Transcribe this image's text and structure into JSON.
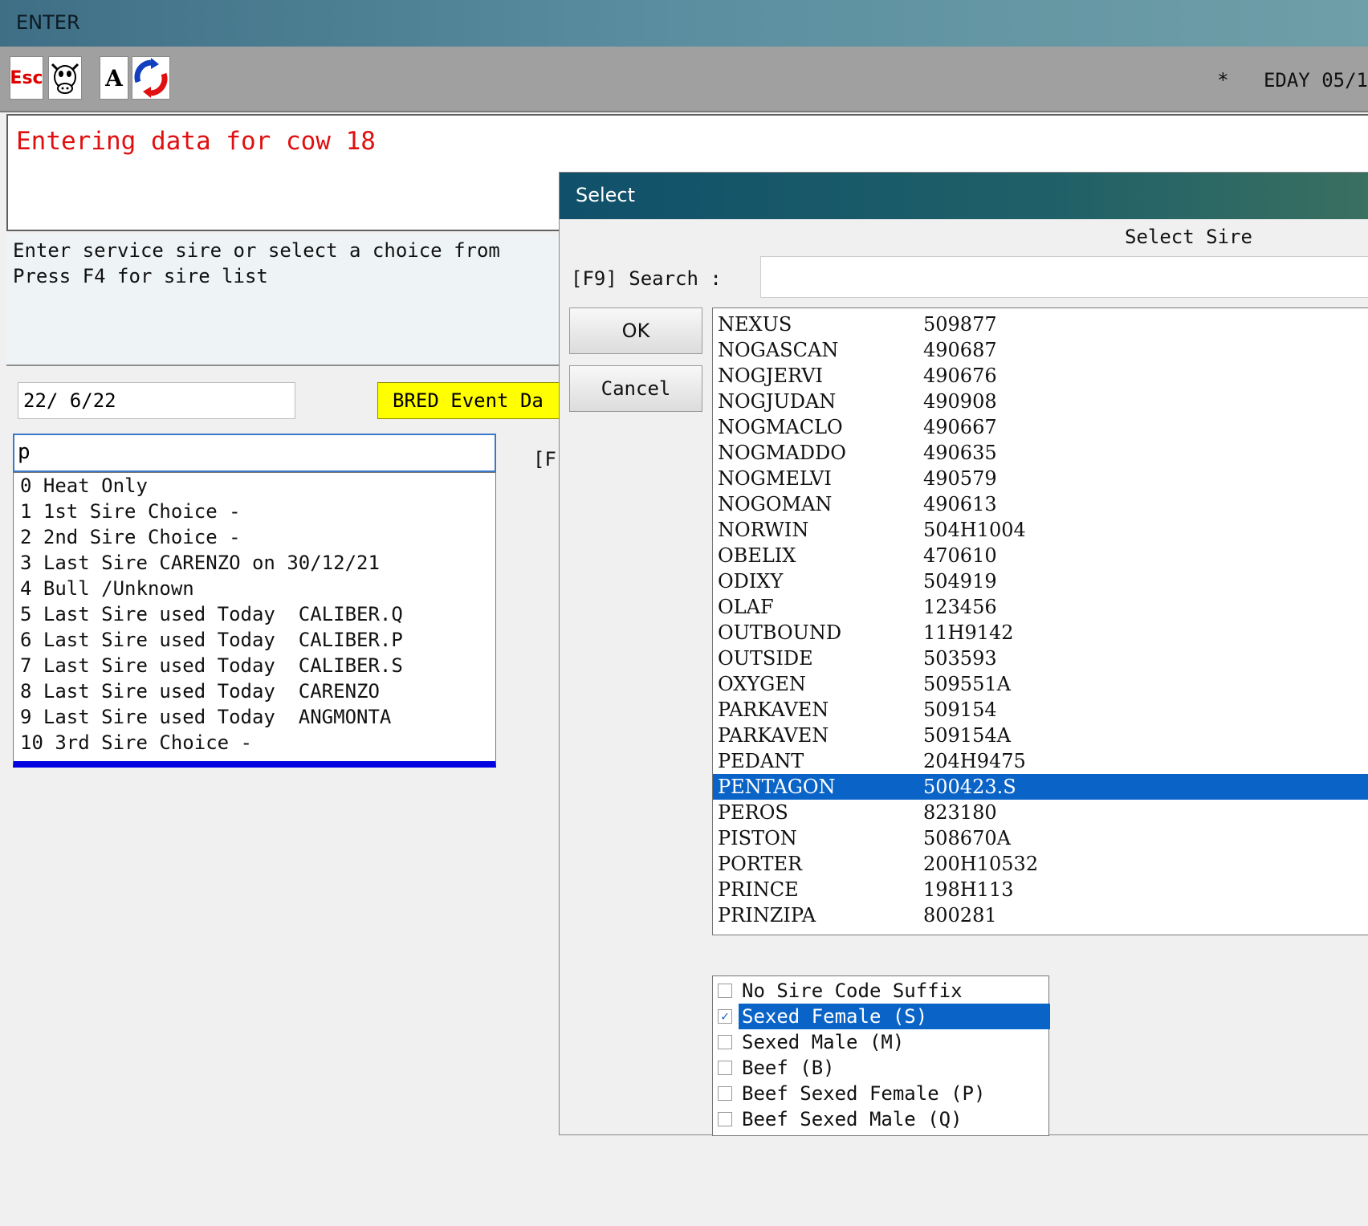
{
  "window": {
    "title": "ENTER"
  },
  "toolbar": {
    "esc_label": "Esc",
    "a_label": "A",
    "status": "*   EDAY 05/1"
  },
  "message": "Entering data for cow 18",
  "info": {
    "line1": "Enter service sire or select a choice from",
    "line2": "Press F4 for sire list"
  },
  "date_value": "22/ 6/22",
  "bred_button": "BRED Event Da",
  "hint_text": "[F",
  "sire_input_value": "p",
  "choices": [
    "0 Heat Only",
    "1 1st Sire Choice -",
    "2 2nd Sire Choice -",
    "3 Last Sire CARENZO on 30/12/21",
    "4 Bull /Unknown",
    "5 Last Sire used Today  CALIBER.Q",
    "6 Last Sire used Today  CALIBER.P",
    "7 Last Sire used Today  CALIBER.S",
    "8 Last Sire used Today  CARENZO",
    "9 Last Sire used Today  ANGMONTA",
    "10 3rd Sire Choice -"
  ],
  "dialog": {
    "title": "Select",
    "heading": "Select Sire",
    "search_label": "[F9] Search :",
    "search_value": "",
    "ok_label": "OK",
    "cancel_label": "Cancel",
    "sires": [
      {
        "name": "NEXUS",
        "code": "509877"
      },
      {
        "name": "NOGASCAN",
        "code": "490687"
      },
      {
        "name": "NOGJERVI",
        "code": "490676"
      },
      {
        "name": "NOGJUDAN",
        "code": "490908"
      },
      {
        "name": "NOGMACLO",
        "code": "490667"
      },
      {
        "name": "NOGMADDO",
        "code": "490635"
      },
      {
        "name": "NOGMELVI",
        "code": "490579"
      },
      {
        "name": "NOGOMAN",
        "code": "490613"
      },
      {
        "name": "NORWIN",
        "code": "504H1004"
      },
      {
        "name": "OBELIX",
        "code": "470610"
      },
      {
        "name": "ODIXY",
        "code": "504919"
      },
      {
        "name": "OLAF",
        "code": "123456"
      },
      {
        "name": "OUTBOUND",
        "code": "11H9142"
      },
      {
        "name": "OUTSIDE",
        "code": "503593"
      },
      {
        "name": "OXYGEN",
        "code": "509551A"
      },
      {
        "name": "PARKAVEN",
        "code": "509154"
      },
      {
        "name": "PARKAVEN",
        "code": "509154A"
      },
      {
        "name": "PEDANT",
        "code": "204H9475"
      },
      {
        "name": "PENTAGON",
        "code": "500423.S",
        "selected": true
      },
      {
        "name": "PEROS",
        "code": "823180"
      },
      {
        "name": "PISTON",
        "code": "508670A"
      },
      {
        "name": "PORTER",
        "code": "200H10532"
      },
      {
        "name": "PRINCE",
        "code": "198H113"
      },
      {
        "name": "PRINZIPA",
        "code": "800281"
      }
    ],
    "suffixes": [
      {
        "label": "No Sire Code Suffix",
        "checked": false
      },
      {
        "label": "Sexed Female (S)",
        "checked": true
      },
      {
        "label": "Sexed Male (M)",
        "checked": false
      },
      {
        "label": "Beef (B)",
        "checked": false
      },
      {
        "label": "Beef Sexed Female (P)",
        "checked": false
      },
      {
        "label": "Beef Sexed Male (Q)",
        "checked": false
      }
    ]
  }
}
